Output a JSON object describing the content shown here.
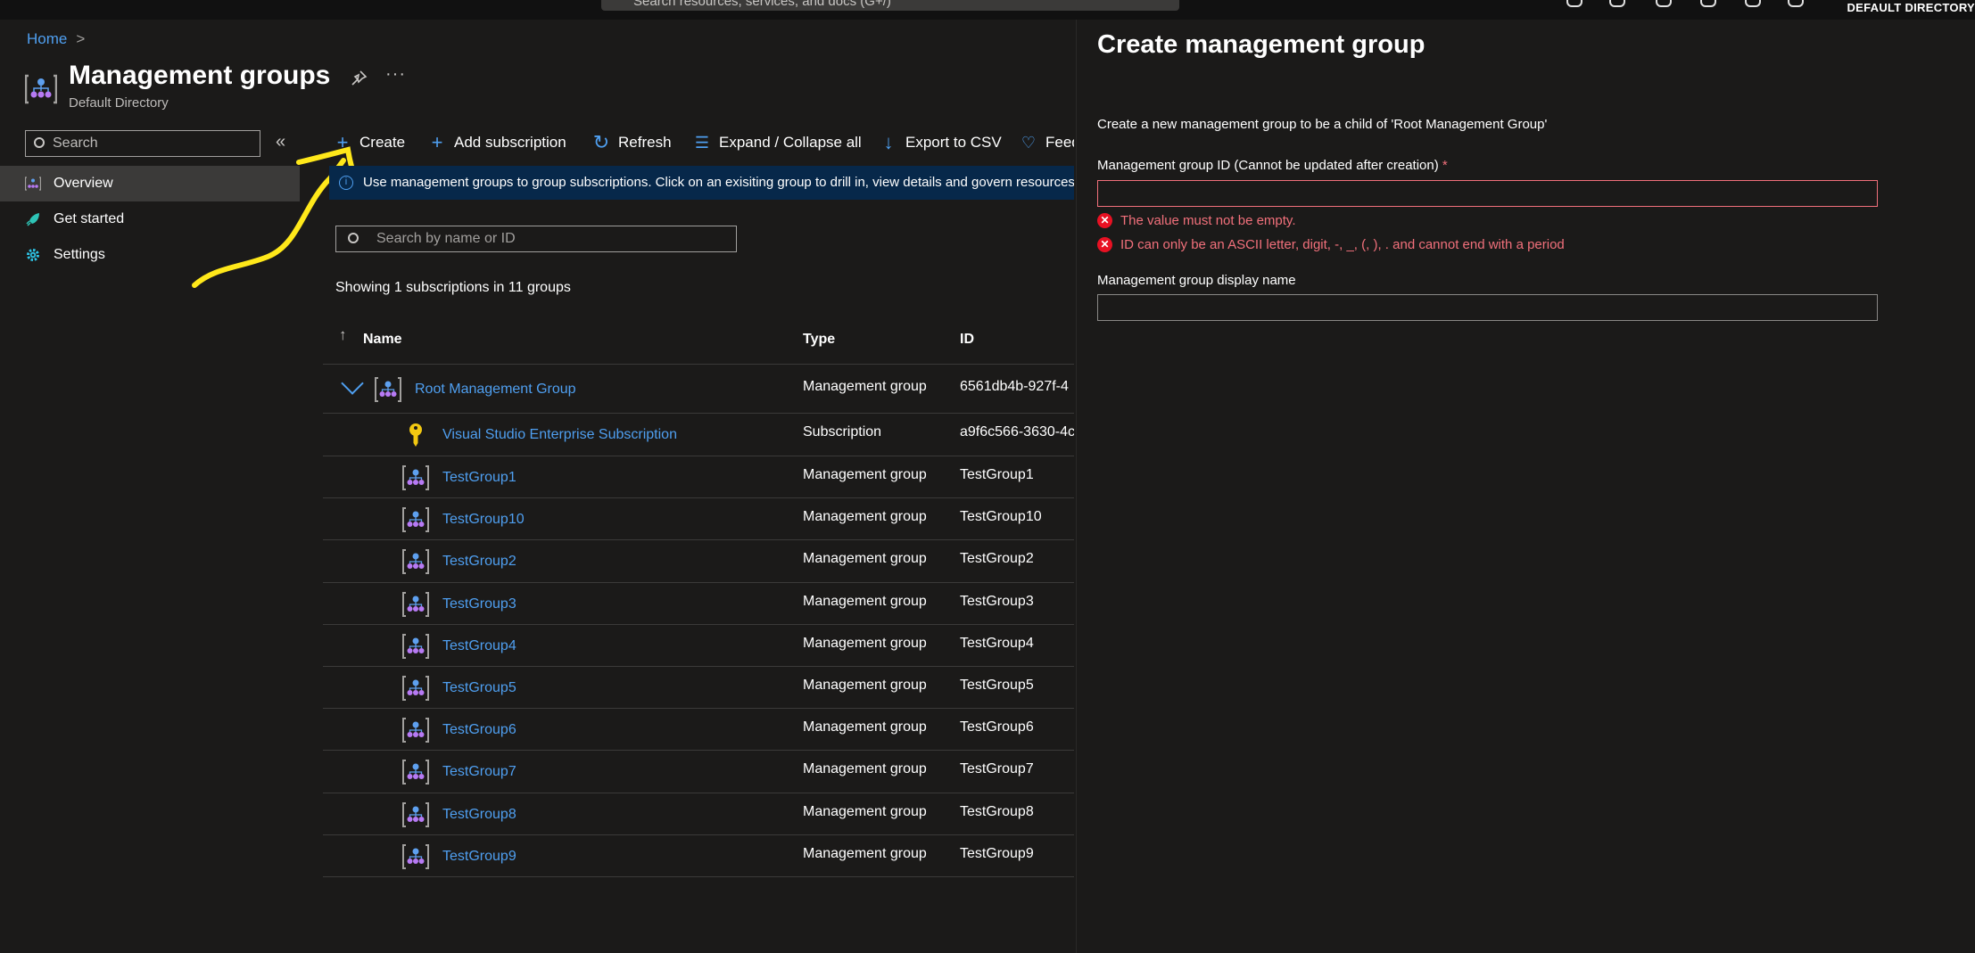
{
  "topbar": {
    "search_placeholder": "Search resources, services, and docs (G+/)",
    "directory": "DEFAULT DIRECTORY"
  },
  "breadcrumb": {
    "home": "Home",
    "separator": ">"
  },
  "page": {
    "title": "Management groups",
    "subtitle": "Default Directory",
    "more": "···"
  },
  "sidebar": {
    "search_placeholder": "Search",
    "collapse": "«",
    "items": [
      {
        "label": "Overview",
        "icon": "management-group-icon",
        "active": true
      },
      {
        "label": "Get started",
        "icon": "rocket-icon"
      },
      {
        "label": "Settings",
        "icon": "gear-icon"
      }
    ]
  },
  "toolbar": {
    "create": "Create",
    "add_subscription": "Add subscription",
    "refresh": "Refresh",
    "expand_collapse": "Expand / Collapse all",
    "export_csv": "Export to CSV",
    "feedback": "Feedback"
  },
  "banner": {
    "text": "Use management groups to group subscriptions. Click on an exisiting group to drill in, view details and govern resources"
  },
  "grid": {
    "search_placeholder": "Search by name or ID",
    "summary": "Showing 1 subscriptions in 11 groups",
    "columns": {
      "name": "Name",
      "type": "Type",
      "id": "ID"
    },
    "rows": [
      {
        "name": "Root Management Group",
        "type": "Management group",
        "id": "6561db4b-927f-4",
        "level": 0,
        "icon": "management-group-icon"
      },
      {
        "name": "Visual Studio Enterprise Subscription",
        "type": "Subscription",
        "id": "a9f6c566-3630-4c",
        "level": 1,
        "icon": "key-icon"
      },
      {
        "name": "TestGroup1",
        "type": "Management group",
        "id": "TestGroup1",
        "level": 1,
        "icon": "management-group-icon"
      },
      {
        "name": "TestGroup10",
        "type": "Management group",
        "id": "TestGroup10",
        "level": 1,
        "icon": "management-group-icon"
      },
      {
        "name": "TestGroup2",
        "type": "Management group",
        "id": "TestGroup2",
        "level": 1,
        "icon": "management-group-icon"
      },
      {
        "name": "TestGroup3",
        "type": "Management group",
        "id": "TestGroup3",
        "level": 1,
        "icon": "management-group-icon"
      },
      {
        "name": "TestGroup4",
        "type": "Management group",
        "id": "TestGroup4",
        "level": 1,
        "icon": "management-group-icon"
      },
      {
        "name": "TestGroup5",
        "type": "Management group",
        "id": "TestGroup5",
        "level": 1,
        "icon": "management-group-icon"
      },
      {
        "name": "TestGroup6",
        "type": "Management group",
        "id": "TestGroup6",
        "level": 1,
        "icon": "management-group-icon"
      },
      {
        "name": "TestGroup7",
        "type": "Management group",
        "id": "TestGroup7",
        "level": 1,
        "icon": "management-group-icon"
      },
      {
        "name": "TestGroup8",
        "type": "Management group",
        "id": "TestGroup8",
        "level": 1,
        "icon": "management-group-icon"
      },
      {
        "name": "TestGroup9",
        "type": "Management group",
        "id": "TestGroup9",
        "level": 1,
        "icon": "management-group-icon"
      }
    ]
  },
  "panel": {
    "title": "Create management group",
    "description": "Create a new management group to be a child of 'Root Management Group'",
    "id_label": "Management group ID (Cannot be updated after creation)",
    "required_mark": "*",
    "id_value": "",
    "errors": [
      "The value must not be empty.",
      "ID can only be an ASCII letter, digit, -, _, (, ), . and cannot end with a period"
    ],
    "display_name_label": "Management group display name",
    "display_name_value": ""
  },
  "colors": {
    "accent": "#4f9ff0",
    "error": "#f1707b",
    "banner": "#07284a",
    "annotation": "#ffe81a"
  }
}
